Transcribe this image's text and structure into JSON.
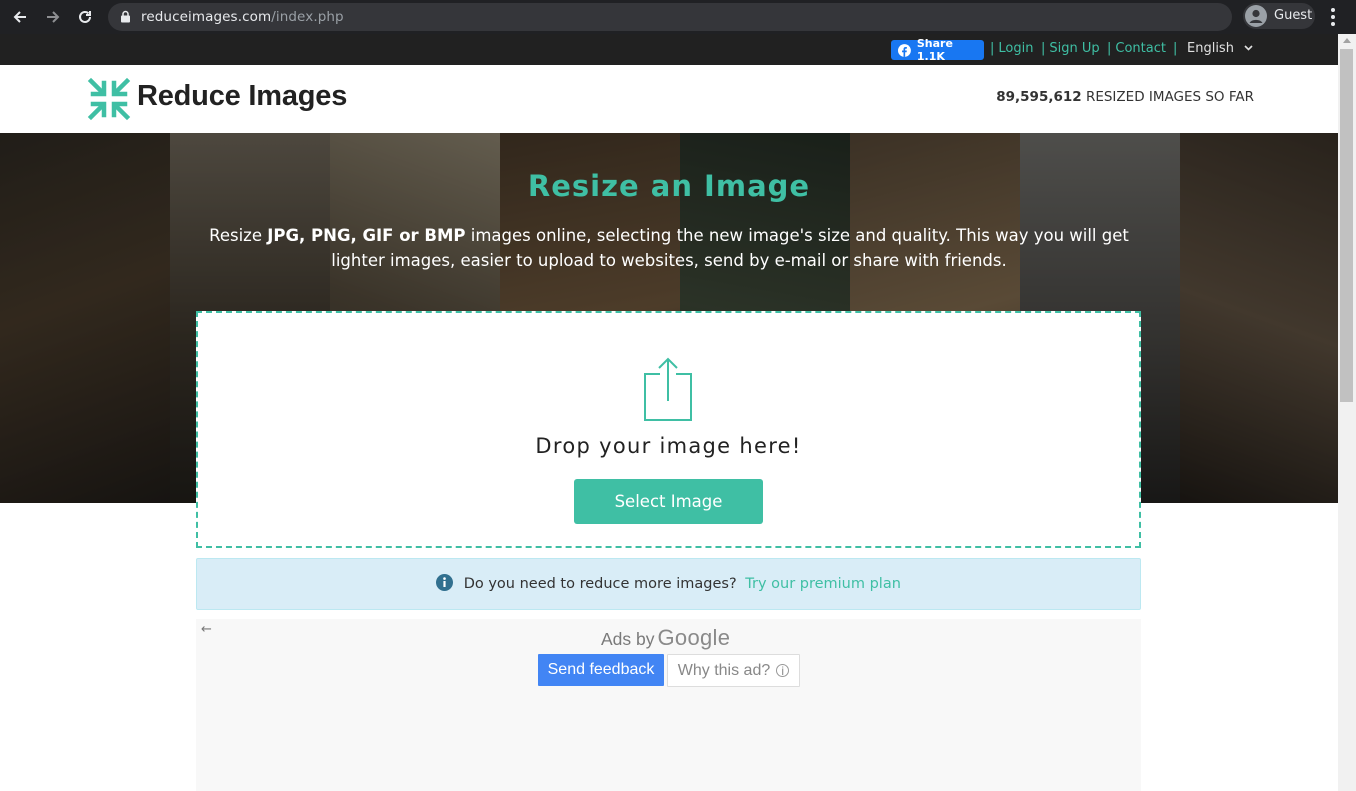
{
  "browser": {
    "url_domain": "reduceimages.com",
    "url_path": "/index.php",
    "profile_label": "Guest"
  },
  "topbar": {
    "share_label": "Share 1.1K",
    "links": [
      {
        "label": "Login"
      },
      {
        "label": "Sign Up"
      },
      {
        "label": "Contact"
      }
    ],
    "language": "English"
  },
  "header": {
    "logo_text": "Reduce Images",
    "counter_number": "89,595,612",
    "counter_suffix": "RESIZED IMAGES SO FAR"
  },
  "hero": {
    "title": "Resize an Image",
    "desc_prefix": "Resize ",
    "desc_formats": "JPG, PNG, GIF or BMP",
    "desc_suffix": " images online, selecting the new image's size and quality. This way you will get lighter images, easier to upload to websites, send by e-mail or share with friends."
  },
  "dropzone": {
    "drop_text": "Drop your image here!",
    "button_label": "Select Image"
  },
  "alert": {
    "text": "Do you need to reduce more images?",
    "link": "Try our premium plan"
  },
  "ad": {
    "back_glyph": "←",
    "ads_by": "Ads by",
    "google": "Google",
    "send_feedback": "Send feedback",
    "why_this_ad": "Why this ad?",
    "info_glyph": "i"
  },
  "colors": {
    "accent": "#3fbfa4",
    "browser_bg": "#202124",
    "topstrip_bg": "#212121",
    "alert_bg": "#d9edf7",
    "facebook_blue": "#1877f2",
    "google_blue": "#4285f4"
  }
}
